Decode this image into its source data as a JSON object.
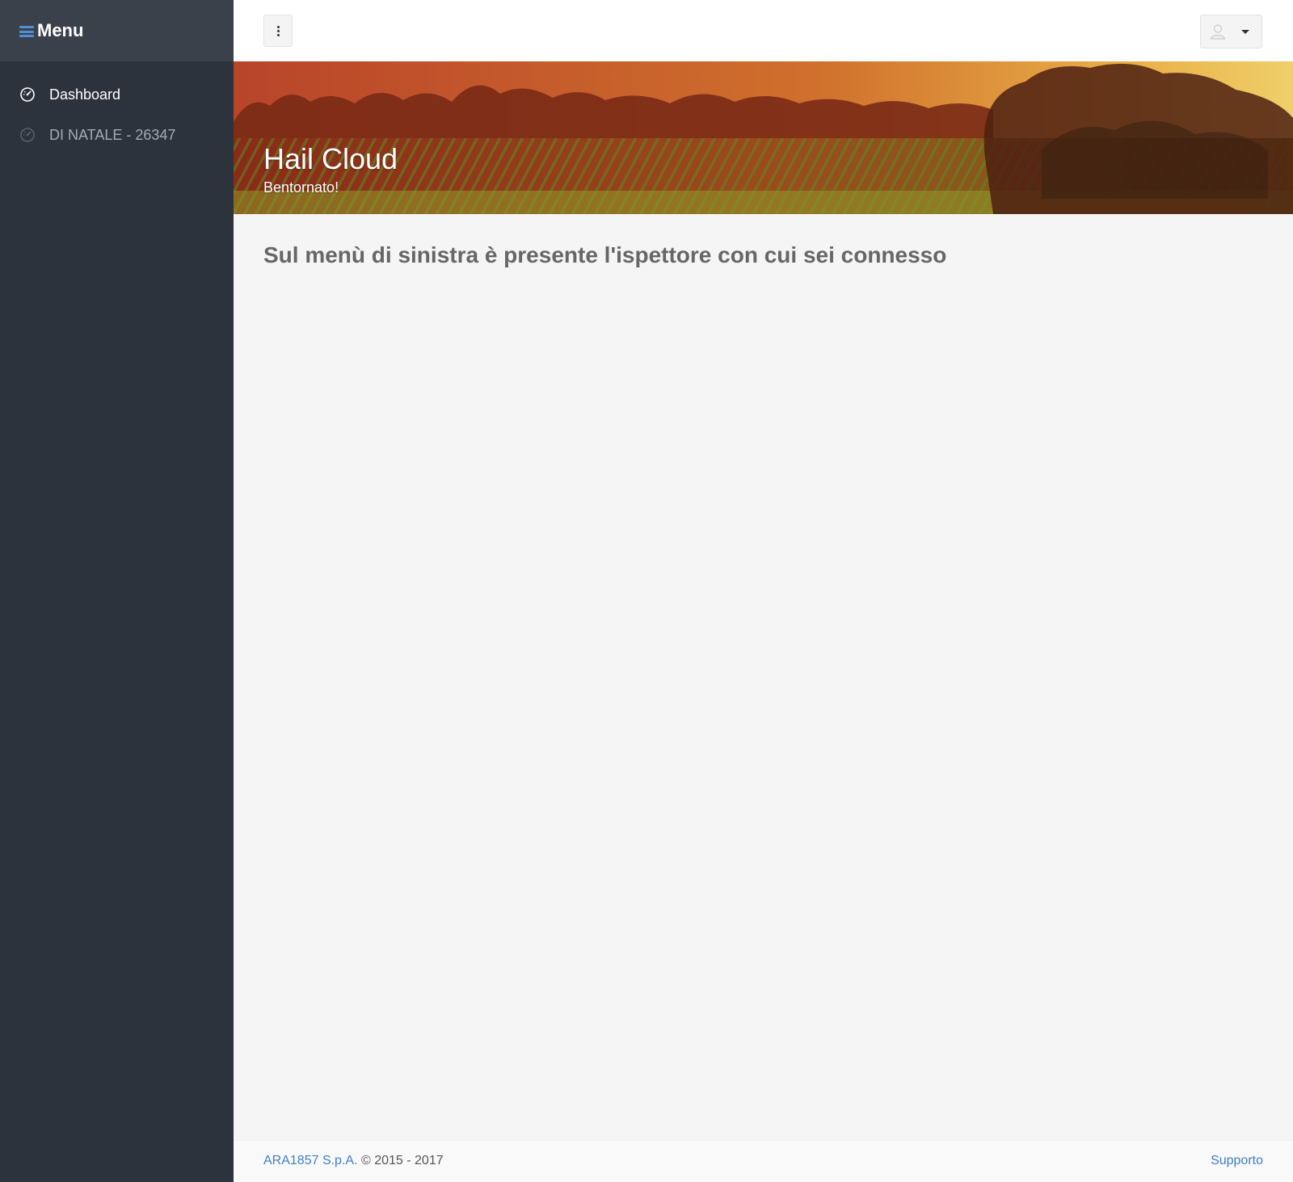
{
  "sidebar": {
    "title": "Menu",
    "items": [
      {
        "label": "Dashboard",
        "icon": "dashboard-gauge-icon"
      },
      {
        "label": "DI NATALE - 26347",
        "icon": "dashboard-gauge-icon"
      }
    ]
  },
  "topbar": {
    "kebab_icon": "vertical-dots-icon",
    "user_icon": "user-icon",
    "caret_icon": "caret-down-icon"
  },
  "banner": {
    "title": "Hail Cloud",
    "subtitle": "Bentornato!"
  },
  "main": {
    "heading": "Sul menù di sinistra è presente l'ispettore con cui sei connesso"
  },
  "footer": {
    "company": "ARA1857 S.p.A.",
    "copyright": "© 2015 - 2017",
    "support_link": "Supporto"
  },
  "colors": {
    "sidebar_bg": "#2d333d",
    "sidebar_header_bg": "#3b414a",
    "accent": "#4f8fd6",
    "link": "#3f7fc4",
    "content_bg": "#f5f5f5"
  }
}
